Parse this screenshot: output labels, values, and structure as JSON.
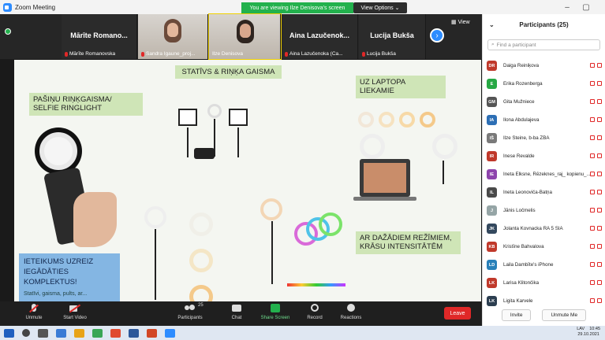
{
  "window": {
    "title": "Zoom Meeting",
    "viewing": "You are viewing Ilze Denisova's screen",
    "view_options": "View Options ⌄",
    "min": "–",
    "max": "▢",
    "close": "✕"
  },
  "strip": {
    "tiles": [
      {
        "name": "Mārīte Romano...",
        "label": "Mārīte Romanovska"
      },
      {
        "name": "",
        "label": "Sandra Igaune_proj..."
      },
      {
        "name": "",
        "label": "Ilze Denisova"
      },
      {
        "name": "Aina Lazučenok...",
        "label": "Aina Lazučenoka (Ca..."
      },
      {
        "name": "Lucija Bukša",
        "label": "Lucija Bukša"
      }
    ],
    "view_label": "View"
  },
  "slide": {
    "title_center": "STATĪVS & RIŅĶA GAISMA",
    "left_tag": "PAŠIŅU RIŅĶGAISMA/ SELFIE RINGLIGHT",
    "right_tag": "UZ LAPTOPA LIEKAMIE",
    "modes_tag": "AR DAŽĀDIEM REŽĪMIEM, KRĀSU INTENSITĀTĒM",
    "recommend_tag": "IETEIKUMS UZREIZ IEGĀDĀTIES KOMPLEKTUS!",
    "recommend_sub": "Statīvi, gaisma, pults, ar..."
  },
  "toolbar": {
    "unmute": "Unmute",
    "start_video": "Start Video",
    "participants": "Participants",
    "participants_count": "25",
    "chat": "Chat",
    "share_screen": "Share Screen",
    "record": "Record",
    "reactions": "Reactions",
    "leave": "Leave"
  },
  "panel": {
    "title": "Participants (25)",
    "search_placeholder": "Find a participant",
    "participants": [
      {
        "initials": "DR",
        "name": "Daiga Reiniķova",
        "color": "#c0392b"
      },
      {
        "initials": "E",
        "name": "Ērika Rozenberga",
        "color": "#27a844"
      },
      {
        "initials": "GM",
        "name": "Gita Mužniece",
        "color": "#555555"
      },
      {
        "initials": "IA",
        "name": "Ilona Abdulajeva",
        "color": "#2d6fb5"
      },
      {
        "initials": "IŠ",
        "name": "Ilze Šteine, b-ba ZBA",
        "color": "#7a7a7a"
      },
      {
        "initials": "IR",
        "name": "Inese Revalde",
        "color": "#c0392b"
      },
      {
        "initials": "IE",
        "name": "Ineta Elksne, Rēzeknes_raj_ kopienu_...",
        "color": "#8e44ad"
      },
      {
        "initials": "IL",
        "name": "Ineta Leonoviča-Batņa",
        "color": "#4a4a4a"
      },
      {
        "initials": "J",
        "name": "Jānis Ločmelis",
        "color": "#95a5a6"
      },
      {
        "initials": "JK",
        "name": "Jolanta Kovnacka RA 5 SIA",
        "color": "#34495e"
      },
      {
        "initials": "KB",
        "name": "Kristīne Bahvalova",
        "color": "#c0392b"
      },
      {
        "initials": "LD",
        "name": "Laila Dambīte's iPhone",
        "color": "#2980b9"
      },
      {
        "initials": "LK",
        "name": "Larisa Klitončika",
        "color": "#c0392b"
      },
      {
        "initials": "LK",
        "name": "Ligita Karvele",
        "color": "#2c3e50"
      }
    ],
    "invite": "Invite",
    "unmute_me": "Unmute Me"
  },
  "taskbar": {
    "time": "10:45",
    "date": "29.10.2021",
    "lang": "LAV"
  }
}
